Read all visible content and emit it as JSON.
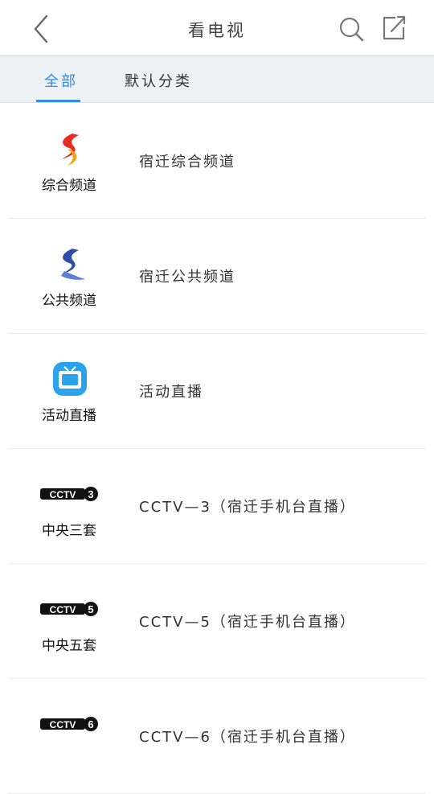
{
  "header": {
    "title": "看电视"
  },
  "tabs": [
    {
      "label": "全部",
      "active": true
    },
    {
      "label": "默认分类",
      "active": false
    }
  ],
  "icons": {
    "back": "chevron-left-icon",
    "search": "search-icon",
    "share": "share-icon"
  },
  "colors": {
    "accent": "#2f8ce8",
    "tab_bar_bg": "#eef1f3"
  },
  "channels": [
    {
      "logo_label": "综合频道",
      "name": "宿迁综合频道",
      "logo": "suqian-red-logo"
    },
    {
      "logo_label": "公共频道",
      "name": "宿迁公共频道",
      "logo": "suqian-blue-logo"
    },
    {
      "logo_label": "活动直播",
      "name": "活动直播",
      "logo": "tv-icon"
    },
    {
      "logo_label": "中央三套",
      "name": "CCTV—3（宿迁手机台直播）",
      "logo": "cctv3-logo",
      "logo_number": "3"
    },
    {
      "logo_label": "中央五套",
      "name": "CCTV—5（宿迁手机台直播）",
      "logo": "cctv5-logo",
      "logo_number": "5"
    },
    {
      "logo_label": "",
      "name": "CCTV—6（宿迁手机台直播）",
      "logo": "cctv6-logo",
      "logo_number": "6"
    }
  ]
}
